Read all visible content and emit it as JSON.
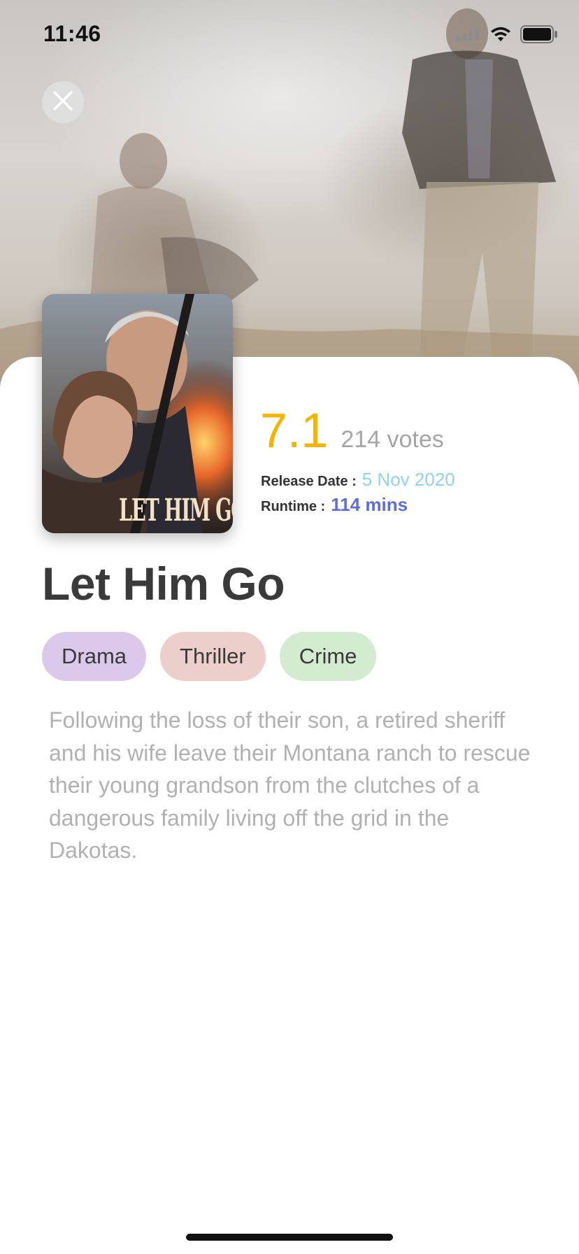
{
  "status_bar": {
    "time": "11:46"
  },
  "icons": {
    "close": "close-icon",
    "signal": "cellular-signal-icon",
    "wifi": "wifi-icon",
    "battery": "battery-icon"
  },
  "movie": {
    "poster_title": "LET HIM GO",
    "title": "Let Him Go",
    "rating": "7.1",
    "votes": "214 votes",
    "release_label": "Release Date :",
    "release_date": "5 Nov 2020",
    "runtime_label": "Runtime :",
    "runtime": "114 mins",
    "genres": [
      {
        "label": "Drama",
        "color": "#dcc8ea"
      },
      {
        "label": "Thriller",
        "color": "#eccfcb"
      },
      {
        "label": "Crime",
        "color": "#d3ebcf"
      }
    ],
    "overview": "Following the loss of their son, a retired sheriff and his wife leave their Montana ranch to rescue their young grandson from the clutches of a dangerous family living off the grid in the Dakotas."
  },
  "colors": {
    "rating": "#f6b400",
    "release_date": "#8fd2ef",
    "runtime": "#5e6ce4"
  }
}
